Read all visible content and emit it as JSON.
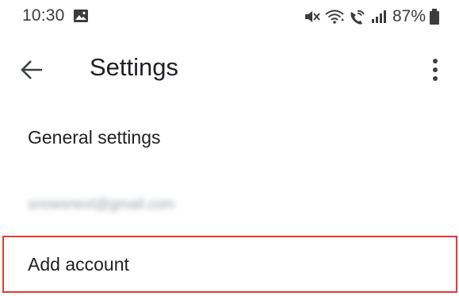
{
  "status_bar": {
    "time": "10:30",
    "battery": "87%",
    "icons": [
      "gallery-icon",
      "mute-icon",
      "wifi-icon",
      "wifi-calling-icon",
      "signal-icon",
      "battery-icon"
    ]
  },
  "toolbar": {
    "title": "Settings",
    "back_icon": "arrow-left-icon",
    "more_icon": "more-vert-icon"
  },
  "settings_list": {
    "items": [
      {
        "label": "General settings"
      },
      {
        "label": "snowsnext@gmail.com"
      },
      {
        "label": "Add account"
      }
    ]
  },
  "colors": {
    "highlight_border": "#e53935",
    "text": "#202124",
    "status": "#3c3c3c"
  }
}
